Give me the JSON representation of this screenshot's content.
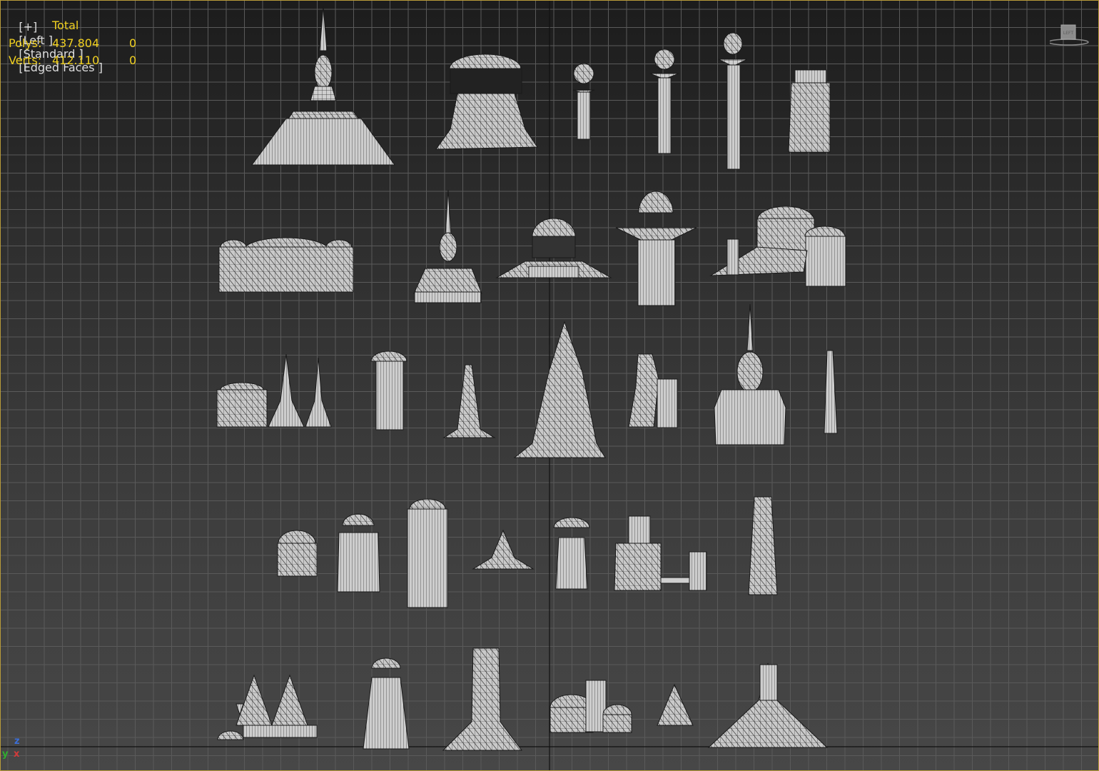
{
  "viewport": {
    "label_plus": "[+]",
    "label_view": "[Left ]",
    "label_shading": "[Standard ]",
    "label_mode": "[Edged Faces ]"
  },
  "stats": {
    "header": "Total",
    "polys_label": "Polys:",
    "polys_total": "437.804",
    "polys_selected": "0",
    "verts_label": "Verts:",
    "verts_total": "412.110",
    "verts_selected": "0"
  },
  "viewcube": {
    "label": "LEFT"
  },
  "axis_tripod": {
    "z": "z",
    "y": "y",
    "x": "x"
  },
  "colors": {
    "grid_line": "#5a5a5a",
    "mesh_fill": "#cfcfcf",
    "mesh_edge": "#1a1a1a",
    "border": "#b89b3a",
    "stat_text": "#f0d020"
  }
}
